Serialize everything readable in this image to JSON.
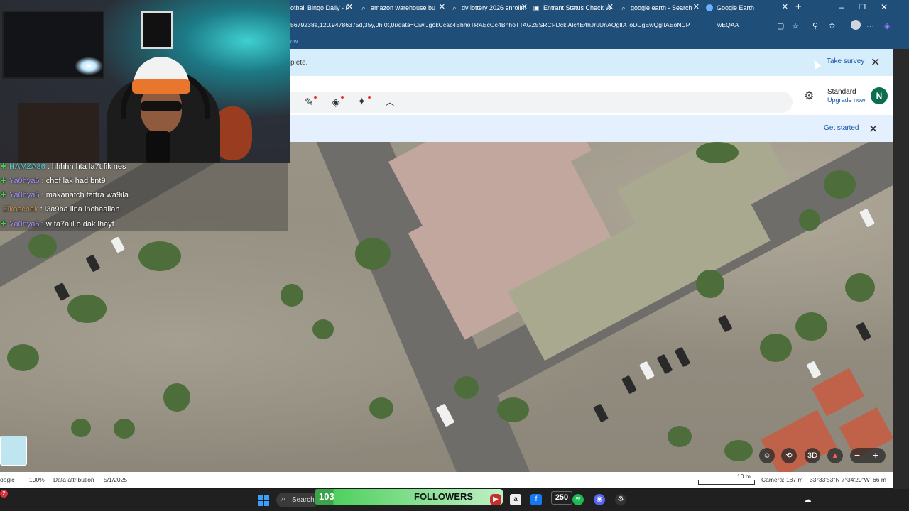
{
  "browser": {
    "tabs": [
      {
        "label": "otball Bingo Daily - F",
        "icon": "page-icon"
      },
      {
        "label": "amazon warehouse bu",
        "icon": "search-icon"
      },
      {
        "label": "dv lottery 2026 enrollm",
        "icon": "search-icon"
      },
      {
        "label": "Entrant Status Check W",
        "icon": "page-icon"
      },
      {
        "label": "google earth - Search",
        "icon": "search-icon"
      },
      {
        "label": "Google Earth",
        "icon": "earth-icon",
        "active": true
      }
    ],
    "url": "5679238a,120.94786375d,35y,0h,0t,0r/data=CiwiJgokCcac4BhhoTRAEcOc4BhhoTTAGZ5SRCPDcklAlc4E4hJruUnAQglIAToDCgEwQgIIAEoNCP________wEQAA",
    "bookmark_text": "ow"
  },
  "survey_banner": {
    "message": "plete.",
    "take_survey": "Take survey"
  },
  "earth_toolbar": {
    "plan": "Standard",
    "upgrade": "Upgrade now",
    "avatar_letter": "N"
  },
  "started_banner": {
    "get_started": "Get started"
  },
  "chat": {
    "messages": [
      {
        "user": "HAMZA36",
        "text": " : hhhhh hta la7t fik nes",
        "color": "#4ad0d8",
        "badge": true
      },
      {
        "user": "Ya0hya5",
        "text": " : chof lak had bnt9",
        "color": "#9f8cff",
        "badge": true
      },
      {
        "user": "Ya0hya5",
        "text": " : makanatch fattra wa9ila",
        "color": "#9f8cff",
        "badge": true
      },
      {
        "user": "Zikoschak",
        "text": " : l3a9ba lina inchaallah",
        "color": "#c58c4c",
        "badge": false
      },
      {
        "user": "Ya0hya5",
        "text": " : w ta7alil o dak lhayt",
        "color": "#9f8cff",
        "badge": true
      }
    ]
  },
  "map_controls": {
    "view_3d": "3D"
  },
  "status_bar": {
    "brand": "oogle",
    "zoom": "100%",
    "attribution": "Data attribution",
    "date": "5/1/2025",
    "scale": "10 m",
    "camera": "Camera: 187 m",
    "coords": "33°33'53\"N 7°34'20\"W",
    "elevation": "66 m"
  },
  "taskbar": {
    "search": "Search",
    "followers_count": "103",
    "followers_label": "FOLLOWERS",
    "badge_count": "250",
    "notification_count": "2"
  },
  "colors": {
    "chrome": "#1f4e79",
    "survey_bg": "#d6eefb",
    "link": "#1a56a8",
    "avatar": "#0b6e4f"
  }
}
